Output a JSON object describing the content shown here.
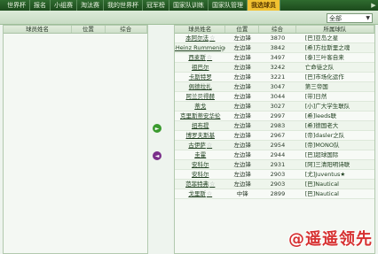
{
  "nav": {
    "items": [
      "世界杯",
      "报名",
      "小组赛",
      "淘汰赛",
      "我的世界杯",
      "冠军榜",
      "国家队训练",
      "国家队管理",
      "我选球员"
    ],
    "active_index": 8
  },
  "filter": {
    "selected": "全部"
  },
  "left_table": {
    "headers": [
      "球员姓名",
      "位置",
      "综合"
    ],
    "rows": []
  },
  "right_table": {
    "headers": [
      "球员姓名",
      "位置",
      "综合",
      "所属球队"
    ],
    "rows": [
      {
        "name": "本阿尔法",
        "star": true,
        "pos": "左边锋",
        "rating": "3870",
        "team": "[巴]亚岛之星"
      },
      {
        "name": "Karl-Heinz Rummenigge",
        "star": true,
        "pos": "左边锋",
        "rating": "3842",
        "team": "[希]方拉斯里之魂"
      },
      {
        "name": "西麦斯",
        "star": true,
        "pos": "左边锋",
        "rating": "3497",
        "team": "[泰]三叶客自来"
      },
      {
        "name": "祖巴尔",
        "star": false,
        "pos": "左边锋",
        "rating": "3242",
        "team": "亡命徒之队"
      },
      {
        "name": "卡斯特罗",
        "star": false,
        "pos": "左边锋",
        "rating": "3221",
        "team": "[巴]市场化运作"
      },
      {
        "name": "佩德拉扎",
        "star": false,
        "pos": "左边锋",
        "rating": "3047",
        "team": "第三帝国"
      },
      {
        "name": "阿兰贝得赫",
        "star": false,
        "pos": "左边锋",
        "rating": "3044",
        "team": "[带]日然"
      },
      {
        "name": "蒂戈",
        "star": false,
        "pos": "左边锋",
        "rating": "3027",
        "team": "[小]广大学生联队"
      },
      {
        "name": "克里斯蒂安华伦",
        "star": false,
        "pos": "左边锋",
        "rating": "2997",
        "team": "[希]leeds联"
      },
      {
        "name": "扭布提",
        "star": false,
        "pos": "左边锋",
        "rating": "2983",
        "team": "[希]德国老大"
      },
      {
        "name": "博罗夫斯基",
        "star": false,
        "pos": "左边锋",
        "rating": "2967",
        "team": "[帝]dasler之队"
      },
      {
        "name": "古伊萨",
        "star": true,
        "pos": "左边锋",
        "rating": "2954",
        "team": "[帝]MONO队"
      },
      {
        "name": "圭霍",
        "star": false,
        "pos": "左边锋",
        "rating": "2944",
        "team": "[巴]超球国际"
      },
      {
        "name": "安科尔",
        "star": false,
        "pos": "左边锋",
        "rating": "2931",
        "team": "[阿]三清阳明诗联"
      },
      {
        "name": "安科尔",
        "star": false,
        "pos": "左边锋",
        "rating": "2903",
        "team": "[尤]Juventus★"
      },
      {
        "name": "范菲特弗",
        "star": true,
        "pos": "左边锋",
        "rating": "2903",
        "team": "[巴]Nautical"
      },
      {
        "name": "戈里斯",
        "star": true,
        "pos": "中锋",
        "rating": "2899",
        "team": "[巴]Nautical"
      }
    ]
  },
  "buttons": {
    "add_label": "►",
    "remove_label": "◄"
  },
  "watermark": "@遥遥领先"
}
